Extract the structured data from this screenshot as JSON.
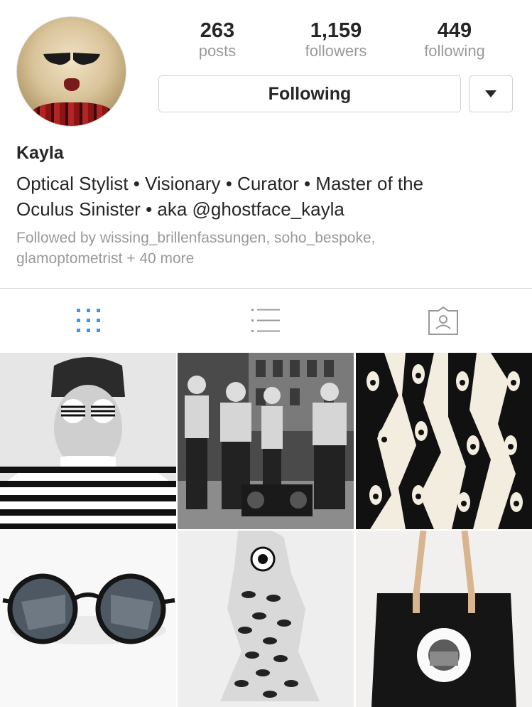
{
  "profile": {
    "name": "Kayla",
    "bio_line1": "Optical Stylist • Visionary • Curator • Master of the",
    "bio_line2": "Oculus Sinister • aka @ghostface_kayla",
    "followed_line1": "Followed by wissing_brillenfassungen, soho_bespoke,",
    "followed_line2": "glamoptometrist + 40 more"
  },
  "stats": [
    {
      "value": "263",
      "label": "posts"
    },
    {
      "value": "1,159",
      "label": "followers"
    },
    {
      "value": "449",
      "label": "following"
    }
  ],
  "actions": {
    "follow_label": "Following",
    "dropdown_icon": "caret-down-icon"
  },
  "tabs": [
    {
      "icon": "grid-view-icon",
      "active": true
    },
    {
      "icon": "list-view-icon",
      "active": false
    },
    {
      "icon": "tagged-photos-icon",
      "active": false
    }
  ],
  "colors": {
    "active_tab": "#3897f0",
    "inactive_tab": "#999999",
    "secondary_text": "#999999"
  },
  "posts": [
    {
      "id": "post-1",
      "subject": "man in striped shirt with striped sunglasses"
    },
    {
      "id": "post-2",
      "subject": "street group with boombox wearing sunglasses"
    },
    {
      "id": "post-3",
      "subject": "black and white eye pattern silhouettes"
    },
    {
      "id": "post-4",
      "subject": "round sunglasses"
    },
    {
      "id": "post-5",
      "subject": "collage figure covered in eyes"
    },
    {
      "id": "post-6",
      "subject": "black tote bag with eye print"
    }
  ]
}
